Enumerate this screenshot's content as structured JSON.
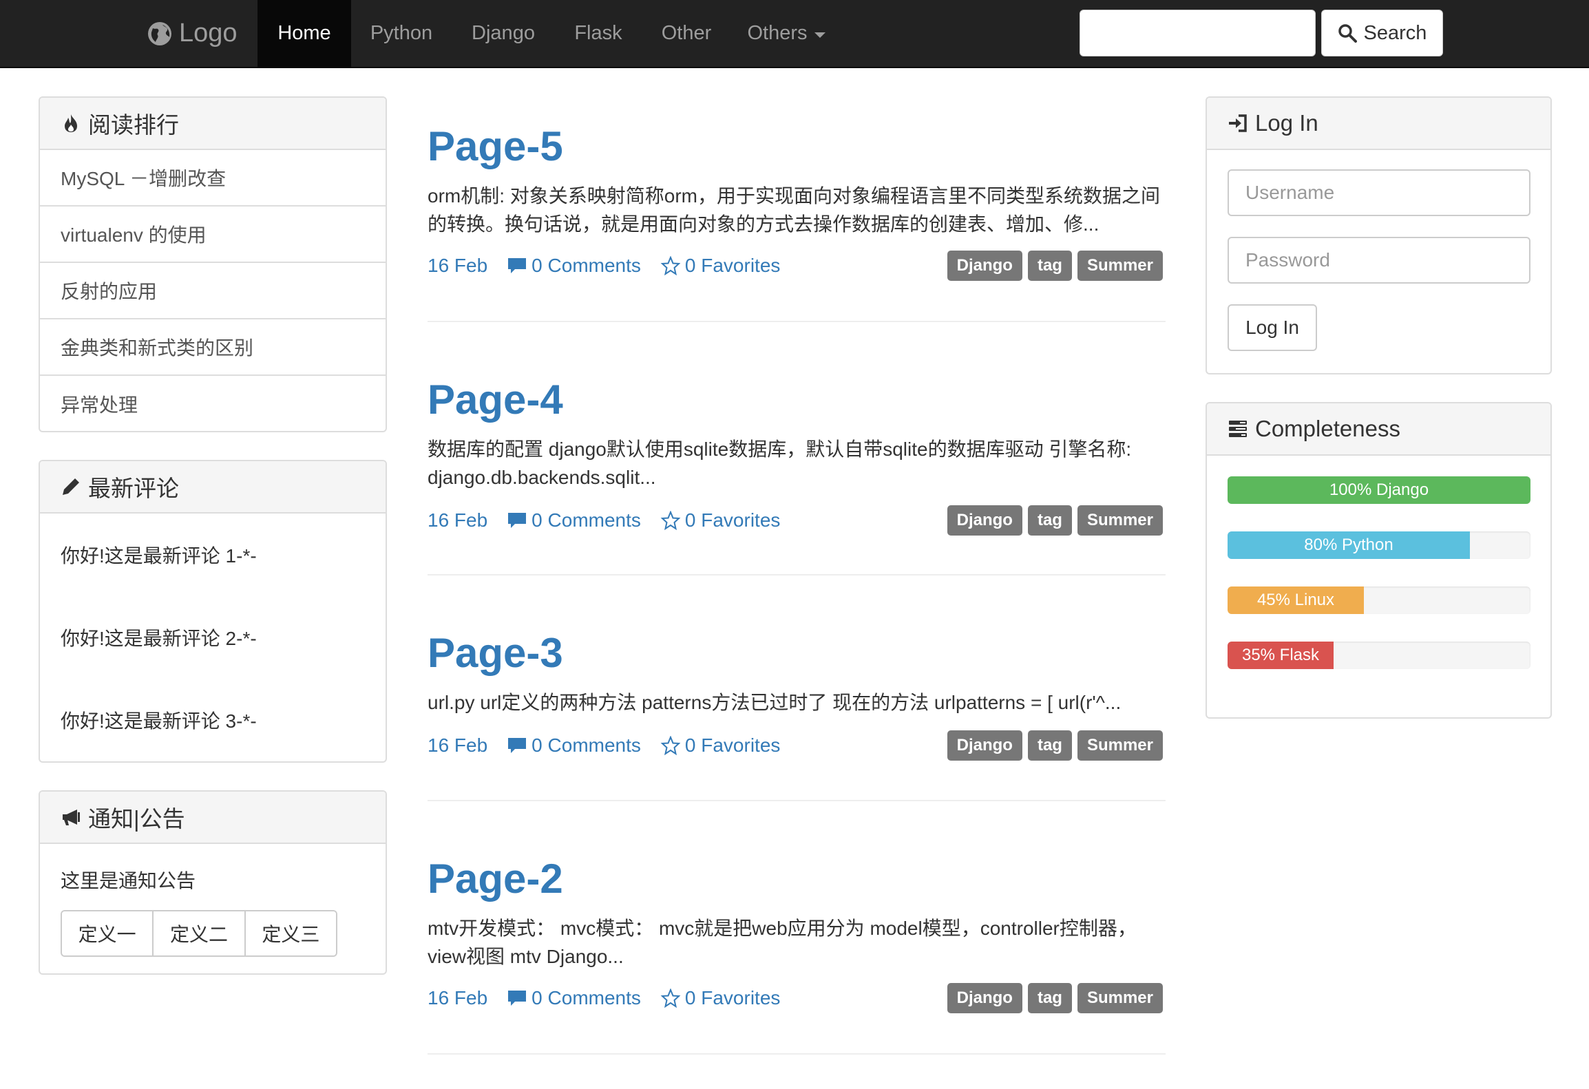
{
  "navbar": {
    "brand": "Logo",
    "items": [
      {
        "label": "Home",
        "active": true
      },
      {
        "label": "Python"
      },
      {
        "label": "Django"
      },
      {
        "label": "Flask"
      },
      {
        "label": "Other"
      },
      {
        "label": "Others",
        "dropdown": true
      }
    ],
    "search_placeholder": "",
    "search_button": "Search"
  },
  "left_sidebar": {
    "reading_rank": {
      "title": "阅读排行",
      "icon": "fire-icon",
      "items": [
        "MySQL －增删改查",
        "virtualenv 的使用",
        "反射的应用",
        "金典类和新式类的区别",
        "异常处理"
      ]
    },
    "latest_comments": {
      "title": "最新评论",
      "icon": "pencil-icon",
      "items": [
        "你好!这是最新评论 1-*-",
        "你好!这是最新评论 2-*-",
        "你好!这是最新评论 3-*-"
      ]
    },
    "notice": {
      "title": "通知|公告",
      "icon": "bullhorn-icon",
      "text": "这里是通知公告",
      "buttons": [
        "定义一",
        "定义二",
        "定义三"
      ]
    }
  },
  "articles": [
    {
      "title": "Page-5",
      "summary": "orm机制: 对象关系映射简称orm，用于实现面向对象编程语言里不同类型系统数据之间的转换。换句话说，就是用面向对象的方式去操作数据库的创建表、增加、修...",
      "date": "16 Feb",
      "comments": "0 Comments",
      "favorites": "0 Favorites",
      "tags": [
        "Django",
        "tag",
        "Summer"
      ]
    },
    {
      "title": "Page-4",
      "summary": "数据库的配置 django默认使用sqlite数据库，默认自带sqlite的数据库驱动 引擎名称: django.db.backends.sqlit...",
      "date": "16 Feb",
      "comments": "0 Comments",
      "favorites": "0 Favorites",
      "tags": [
        "Django",
        "tag",
        "Summer"
      ]
    },
    {
      "title": "Page-3",
      "summary": "url.py url定义的两种方法 patterns方法已过时了 现在的方法 urlpatterns = [ url(r'^...",
      "date": "16 Feb",
      "comments": "0 Comments",
      "favorites": "0 Favorites",
      "tags": [
        "Django",
        "tag",
        "Summer"
      ]
    },
    {
      "title": "Page-2",
      "summary": "mtv开发模式： mvc模式： mvc就是把web应用分为 model模型，controller控制器，view视图 mtv Django...",
      "date": "16 Feb",
      "comments": "0 Comments",
      "favorites": "0 Favorites",
      "tags": [
        "Django",
        "tag",
        "Summer"
      ]
    }
  ],
  "right_sidebar": {
    "login": {
      "title": "Log In",
      "icon": "login-icon",
      "username_placeholder": "Username",
      "password_placeholder": "Password",
      "button": "Log In"
    },
    "completeness": {
      "title": "Completeness",
      "icon": "tasks-icon",
      "bars": [
        {
          "label": "100% Django",
          "percent": 100,
          "color": "#5cb85c"
        },
        {
          "label": "80% Python",
          "percent": 80,
          "color": "#5bc0de"
        },
        {
          "label": "45% Linux",
          "percent": 45,
          "color": "#f0ad4e"
        },
        {
          "label": "35% Flask",
          "percent": 35,
          "color": "#d9534f"
        }
      ]
    }
  },
  "colors": {
    "navbar_bg": "#222222",
    "link": "#337ab7",
    "tag_bg": "#777777"
  }
}
